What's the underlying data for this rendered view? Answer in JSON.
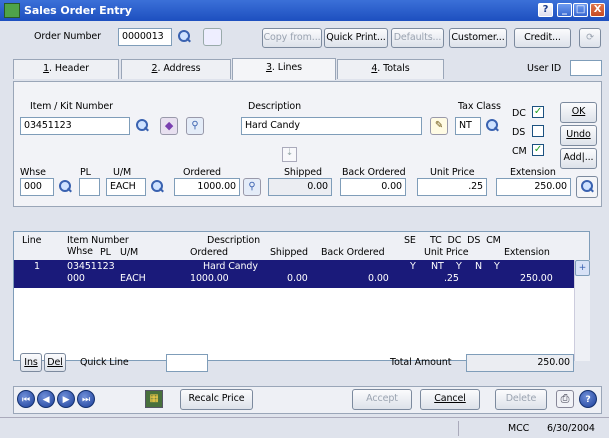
{
  "window": {
    "title": "Sales Order Entry",
    "help": "?",
    "minimize": "_",
    "restore": "□",
    "close": "X"
  },
  "header": {
    "order_number_label": "Order Number",
    "order_number": "0000013",
    "copy_from": "Copy from...",
    "quick_print": "Quick Print...",
    "defaults": "Defaults...",
    "customer": "Customer...",
    "credit": "Credit..."
  },
  "tabs": [
    {
      "num": "1",
      "label": ". Header"
    },
    {
      "num": "2",
      "label": ". Address"
    },
    {
      "num": "3",
      "label": ". Lines"
    },
    {
      "num": "4",
      "label": ". Totals"
    }
  ],
  "user_id_label": "User ID",
  "line": {
    "item_label": "Item / Kit Number",
    "item": "03451123",
    "desc_label": "Description",
    "desc": "Hard Candy",
    "tax_label": "Tax Class",
    "tax": "NT",
    "dc_label": "DC",
    "ds_label": "DS",
    "cm_label": "CM",
    "dc_checked": true,
    "ds_checked": false,
    "cm_checked": true,
    "ok": "OK",
    "undo": "Undo",
    "add": "Add|...",
    "whse_label": "Whse",
    "pl_label": "PL",
    "um_label": "U/M",
    "ordered_label": "Ordered",
    "shipped_label": "Shipped",
    "backordered_label": "Back Ordered",
    "unitprice_label": "Unit Price",
    "extension_label": "Extension",
    "whse": "000",
    "pl": "",
    "um": "EACH",
    "ordered": "1000.00",
    "shipped": "0.00",
    "backordered": "0.00",
    "unitprice": ".25",
    "extension": "250.00"
  },
  "grid": {
    "h1": {
      "line": "Line",
      "item": "Item Number",
      "desc": "Description",
      "se": "SE",
      "flags": "TC  DC  DS  CM"
    },
    "h2": {
      "whse": "Whse",
      "pl": "PL",
      "um": "U/M",
      "ordered": "Ordered",
      "shipped": "Shipped",
      "backordered": "Back Ordered",
      "unitprice": "Unit Price",
      "extension": "Extension"
    },
    "rows": [
      {
        "line": "1",
        "item": "03451123",
        "desc": "Hard Candy",
        "se": "Y",
        "tc": "NT",
        "dc": "Y",
        "ds": "N",
        "cm": "Y",
        "whse": "000",
        "um": "EACH",
        "ordered": "1000.00",
        "shipped": "0.00",
        "backordered": "0.00",
        "unitprice": ".25",
        "extension": "250.00"
      }
    ]
  },
  "footer": {
    "ins": "Ins",
    "del": "Del",
    "quick_line_label": "Quick Line",
    "quick_line": "",
    "total_label": "Total Amount",
    "total": "250.00"
  },
  "bottom": {
    "recalc": "Recalc Price",
    "accept": "Accept",
    "cancel": "Cancel",
    "delete": "Delete"
  },
  "status": {
    "company": "MCC",
    "date": "6/30/2004"
  },
  "colors": {
    "titlebar": "#1d4fbf",
    "selected_row": "#1a1a7a",
    "check": "#21a121"
  }
}
